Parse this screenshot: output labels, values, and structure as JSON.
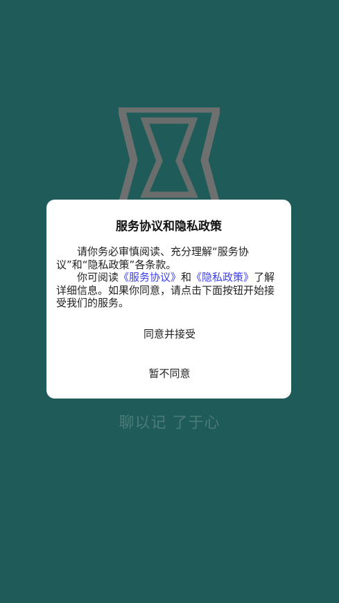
{
  "app": {
    "slogan": "聊以记 了于心"
  },
  "dialog": {
    "title": "服务协议和隐私政策",
    "paragraph1": "请你务必审慎阅读、充分理解“服务协议”和“隐私政策”各条款。",
    "paragraph2_prefix": "你可阅读",
    "service_link": "《服务协议》",
    "connector": "和",
    "privacy_link": "《隐私政策》",
    "paragraph2_suffix": "了解详细信息。如果你同意，请点击下面按钮开始接受我们的服务。",
    "accept_label": "同意并接受",
    "decline_label": "暂不同意"
  },
  "colors": {
    "background": "#1f5c59",
    "logo": "#6e6f6f",
    "link": "#3a3ef0"
  },
  "icons": {
    "logo": "hourglass-logo-icon"
  }
}
